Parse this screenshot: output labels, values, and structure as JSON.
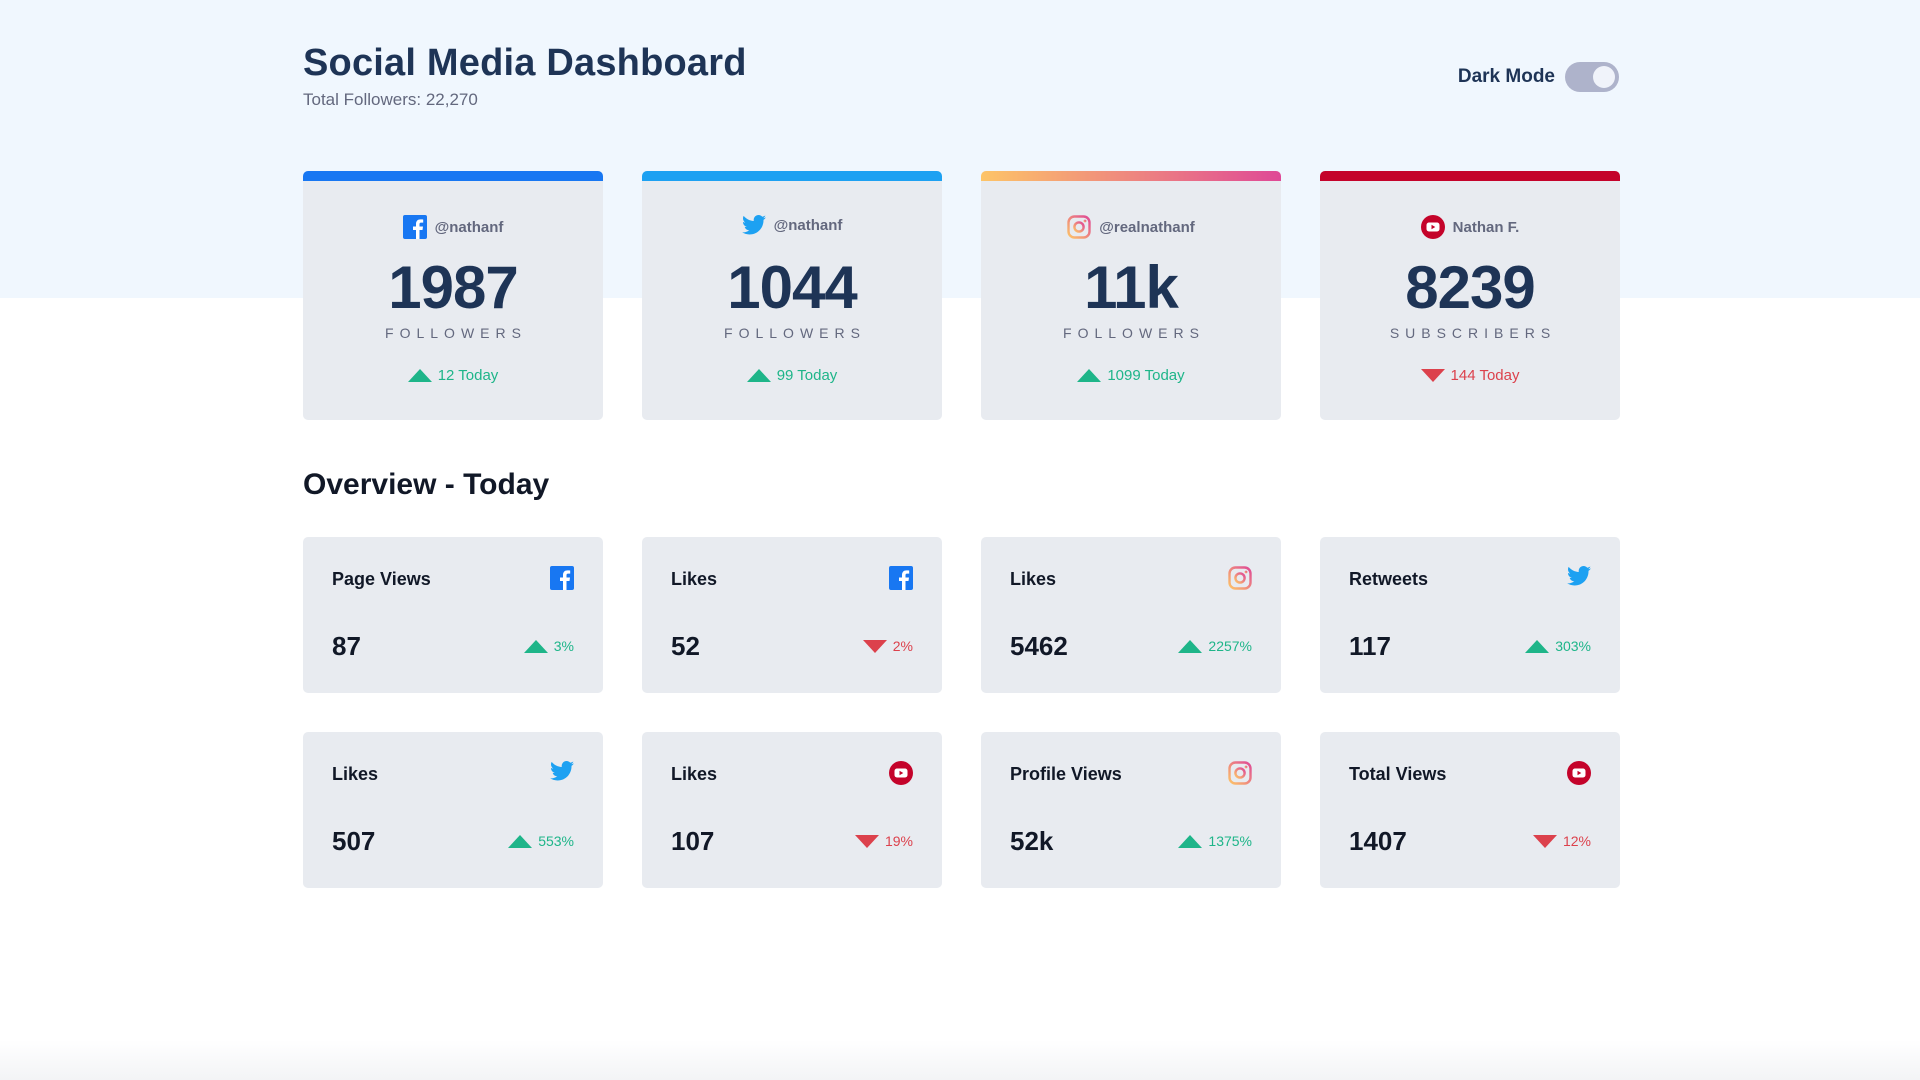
{
  "header": {
    "title": "Social Media Dashboard",
    "subtitle": "Total Followers: 22,270",
    "mode_label": "Dark Mode",
    "dark_mode_on": false
  },
  "colors": {
    "facebook": "#1877f2",
    "twitter": "#1da1f2",
    "instagram_gradient": [
      "#fdc468",
      "#df4996"
    ],
    "youtube": "#c4032a",
    "up": "#1eb589",
    "down": "#dc414c"
  },
  "followers": [
    {
      "platform": "facebook",
      "icon": "facebook-icon",
      "handle": "@nathanf",
      "count": "1987",
      "unit": "FOLLOWERS",
      "today": "12 Today",
      "trend": "up"
    },
    {
      "platform": "twitter",
      "icon": "twitter-icon",
      "handle": "@nathanf",
      "count": "1044",
      "unit": "FOLLOWERS",
      "today": "99 Today",
      "trend": "up"
    },
    {
      "platform": "instagram",
      "icon": "instagram-icon",
      "handle": "@realnathanf",
      "count": "11k",
      "unit": "FOLLOWERS",
      "today": "1099 Today",
      "trend": "up"
    },
    {
      "platform": "youtube",
      "icon": "youtube-icon",
      "handle": "Nathan F.",
      "count": "8239",
      "unit": "SUBSCRIBERS",
      "today": "144 Today",
      "trend": "down"
    }
  ],
  "overview": {
    "title": "Overview - Today",
    "items": [
      {
        "label": "Page Views",
        "platform": "facebook",
        "icon": "facebook-icon",
        "value": "87",
        "change": "3%",
        "trend": "up"
      },
      {
        "label": "Likes",
        "platform": "facebook",
        "icon": "facebook-icon",
        "value": "52",
        "change": "2%",
        "trend": "down"
      },
      {
        "label": "Likes",
        "platform": "instagram",
        "icon": "instagram-icon",
        "value": "5462",
        "change": "2257%",
        "trend": "up"
      },
      {
        "label": "Retweets",
        "platform": "twitter",
        "icon": "twitter-icon",
        "value": "117",
        "change": "303%",
        "trend": "up"
      },
      {
        "label": "Likes",
        "platform": "twitter",
        "icon": "twitter-icon",
        "value": "507",
        "change": "553%",
        "trend": "up"
      },
      {
        "label": "Likes",
        "platform": "youtube",
        "icon": "youtube-icon",
        "value": "107",
        "change": "19%",
        "trend": "down"
      },
      {
        "label": "Profile Views",
        "platform": "instagram",
        "icon": "instagram-icon",
        "value": "52k",
        "change": "1375%",
        "trend": "up"
      },
      {
        "label": "Total Views",
        "platform": "youtube",
        "icon": "youtube-icon",
        "value": "1407",
        "change": "12%",
        "trend": "down"
      }
    ]
  }
}
